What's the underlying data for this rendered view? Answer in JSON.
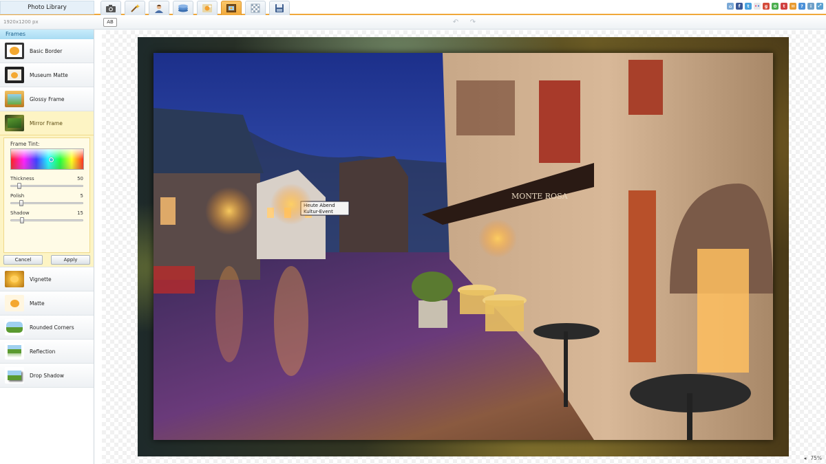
{
  "app": {
    "title": "Photo Library"
  },
  "toolbar": {
    "tools": [
      {
        "name": "camera-icon",
        "active": false
      },
      {
        "name": "magic-wand-icon",
        "active": false
      },
      {
        "name": "portrait-icon",
        "active": false
      },
      {
        "name": "layers-icon",
        "active": false
      },
      {
        "name": "effects-icon",
        "active": false
      },
      {
        "name": "frames-icon",
        "active": true
      },
      {
        "name": "texture-icon",
        "active": false
      },
      {
        "name": "save-icon",
        "active": false
      }
    ],
    "share": [
      {
        "name": "home-icon",
        "color": "#7aa8d6"
      },
      {
        "name": "facebook-icon",
        "color": "#3b5998"
      },
      {
        "name": "twitter-icon",
        "color": "#4aa3df"
      },
      {
        "name": "flickr-icon",
        "color": "#e8e8e8"
      },
      {
        "name": "google-icon",
        "color": "#d44b3a"
      },
      {
        "name": "picasa-icon",
        "color": "#4caf50"
      },
      {
        "name": "tumblr-icon",
        "color": "#d04040"
      },
      {
        "name": "email-icon",
        "color": "#e89a30"
      },
      {
        "name": "help-icon",
        "color": "#4a90d9"
      },
      {
        "name": "info-icon",
        "color": "#6fa0c8"
      },
      {
        "name": "fullscreen-icon",
        "color": "#5aa0d0"
      }
    ]
  },
  "subbar": {
    "dimensions": "1920x1200 px",
    "ab_label": "AB"
  },
  "sidebar": {
    "section_title": "Frames",
    "items": [
      {
        "label": "Basic Border"
      },
      {
        "label": "Museum Matte"
      },
      {
        "label": "Glossy Frame"
      },
      {
        "label": "Mirror Frame"
      },
      {
        "label": "Vignette"
      },
      {
        "label": "Matte"
      },
      {
        "label": "Rounded Corners"
      },
      {
        "label": "Reflection"
      },
      {
        "label": "Drop Shadow"
      }
    ],
    "options": {
      "tint_label": "Frame Tint:",
      "thickness": {
        "label": "Thickness",
        "value": "50"
      },
      "polish": {
        "label": "Polish",
        "value": "5"
      },
      "shadow": {
        "label": "Shadow",
        "value": "15"
      },
      "cancel_label": "Cancel",
      "apply_label": "Apply"
    }
  },
  "photo": {
    "sign_line1": "Heute Abend",
    "sign_line2": "Kultur-Event",
    "hotel_sign": "MONTE ROSA"
  },
  "status": {
    "zoom": "75%"
  },
  "colors": {
    "accent": "#f0a83a",
    "header_blue": "#a9dcf3",
    "selected": "#fdf4c4"
  }
}
